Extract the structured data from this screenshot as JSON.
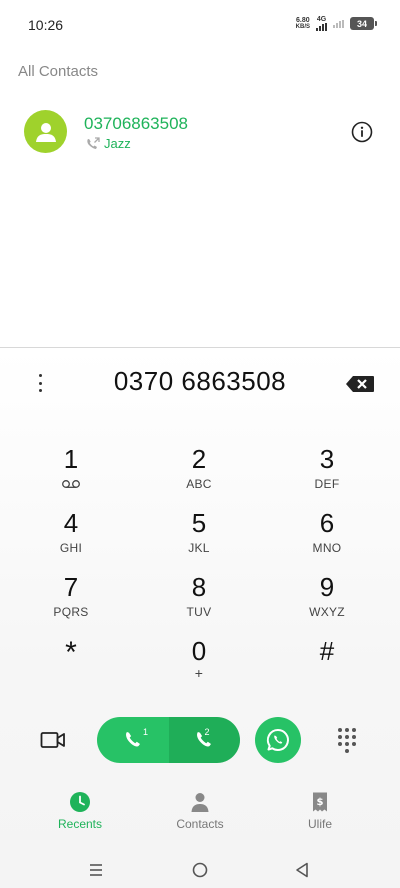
{
  "status_bar": {
    "time": "10:26",
    "net_speed_value": "6.80",
    "net_speed_unit": "KB/S",
    "network_type": "4G",
    "battery": "34"
  },
  "contacts": {
    "section_title": "All Contacts",
    "items": [
      {
        "number": "03706863508",
        "carrier": "Jazz",
        "avatar_color": "#9fd22c"
      }
    ]
  },
  "dialer": {
    "dialed_number": "0370 6863508",
    "keys": [
      {
        "digit": "1",
        "letters": "",
        "sub_icon": "voicemail-icon"
      },
      {
        "digit": "2",
        "letters": "ABC"
      },
      {
        "digit": "3",
        "letters": "DEF"
      },
      {
        "digit": "4",
        "letters": "GHI"
      },
      {
        "digit": "5",
        "letters": "JKL"
      },
      {
        "digit": "6",
        "letters": "MNO"
      },
      {
        "digit": "7",
        "letters": "PQRS"
      },
      {
        "digit": "8",
        "letters": "TUV"
      },
      {
        "digit": "9",
        "letters": "WXYZ"
      },
      {
        "digit": "*",
        "letters": ""
      },
      {
        "digit": "0",
        "letters": "+"
      },
      {
        "digit": "#",
        "letters": ""
      }
    ],
    "sim1_label": "1",
    "sim2_label": "2"
  },
  "bottom_nav": {
    "items": [
      {
        "label": "Recents",
        "icon": "clock-icon",
        "active": true
      },
      {
        "label": "Contacts",
        "icon": "person-icon",
        "active": false
      },
      {
        "label": "Ulife",
        "icon": "wallet-icon",
        "active": false
      }
    ]
  },
  "colors": {
    "accent": "#1fb35a",
    "call_button": "#27c266",
    "call_button_dark": "#1fae58"
  }
}
